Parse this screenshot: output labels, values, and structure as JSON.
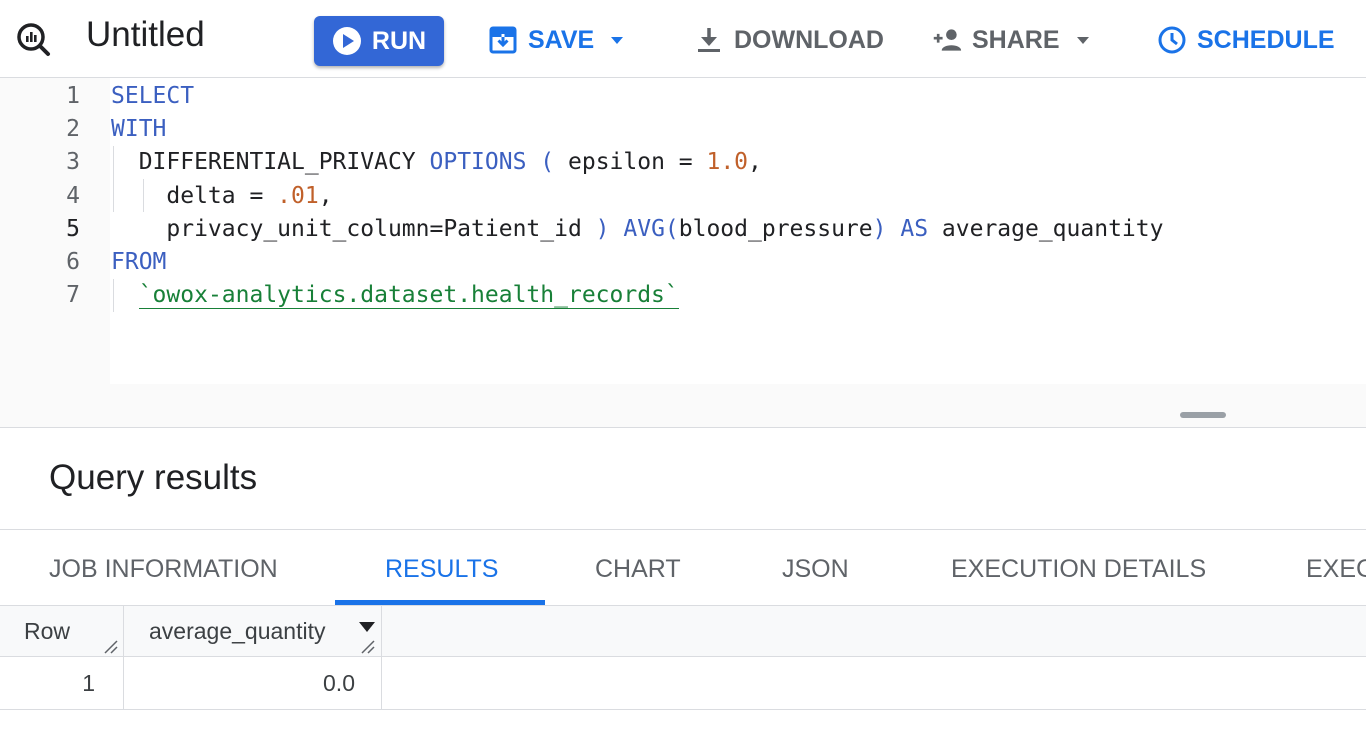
{
  "toolbar": {
    "title": "Untitled",
    "run_label": "RUN",
    "save_label": "SAVE",
    "download_label": "DOWNLOAD",
    "share_label": "SHARE",
    "schedule_label": "SCHEDULE",
    "accent_color": "#1a73e8",
    "run_color": "#3367d6"
  },
  "editor": {
    "line_numbers": [
      "1",
      "2",
      "3",
      "4",
      "5",
      "6",
      "7"
    ],
    "active_line": "5",
    "lines": [
      [
        {
          "t": "SELECT",
          "c": "kw"
        }
      ],
      [
        {
          "t": "WITH",
          "c": "kw"
        }
      ],
      [
        {
          "t": "  DIFFERENTIAL_PRIVACY ",
          "c": ""
        },
        {
          "t": "OPTIONS",
          "c": "kw"
        },
        {
          "t": " ",
          "c": ""
        },
        {
          "t": "(",
          "c": "kw"
        },
        {
          "t": " epsilon = ",
          "c": ""
        },
        {
          "t": "1.0",
          "c": "num"
        },
        {
          "t": ",",
          "c": ""
        }
      ],
      [
        {
          "t": "    delta = ",
          "c": ""
        },
        {
          "t": ".01",
          "c": "num"
        },
        {
          "t": ",",
          "c": ""
        }
      ],
      [
        {
          "t": "    privacy_unit_column=Patient_id ",
          "c": ""
        },
        {
          "t": ")",
          "c": "kw"
        },
        {
          "t": " ",
          "c": ""
        },
        {
          "t": "AVG(",
          "c": "kw"
        },
        {
          "t": "blood_pressure",
          "c": ""
        },
        {
          "t": ")",
          "c": "kw"
        },
        {
          "t": " ",
          "c": ""
        },
        {
          "t": "AS",
          "c": "kw"
        },
        {
          "t": " average_quantity",
          "c": ""
        }
      ],
      [
        {
          "t": "FROM",
          "c": "kw"
        }
      ],
      [
        {
          "t": "  ",
          "c": ""
        },
        {
          "t": "`owox-analytics.dataset.health_records`",
          "c": "str"
        }
      ]
    ]
  },
  "results": {
    "title": "Query results",
    "tabs": [
      {
        "label": "JOB INFORMATION",
        "active": false
      },
      {
        "label": "RESULTS",
        "active": true
      },
      {
        "label": "CHART",
        "active": false
      },
      {
        "label": "JSON",
        "active": false
      },
      {
        "label": "EXECUTION DETAILS",
        "active": false
      },
      {
        "label": "EXECUTION GRAPH",
        "active": false
      }
    ],
    "columns": [
      "Row",
      "average_quantity"
    ],
    "rows": [
      [
        "1",
        "0.0"
      ]
    ]
  }
}
